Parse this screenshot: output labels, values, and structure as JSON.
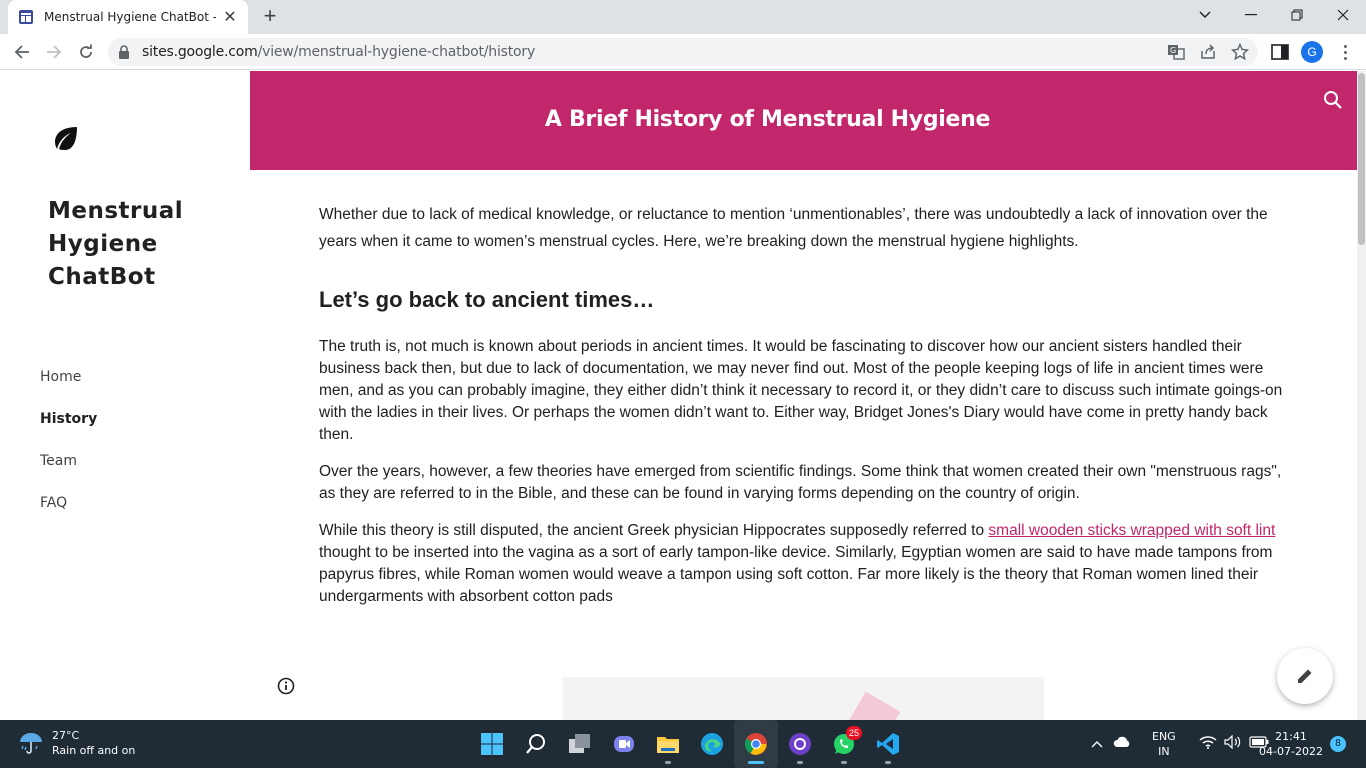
{
  "browser": {
    "tab_title": "Menstrual Hygiene ChatBot - History",
    "url_host": "sites.google.com",
    "url_path": "/view/menstrual-hygiene-chatbot/history",
    "profile_initial": "G"
  },
  "site": {
    "title": "Menstrual Hygiene ChatBot",
    "nav": [
      {
        "label": "Home",
        "active": false
      },
      {
        "label": "History",
        "active": true
      },
      {
        "label": "Team",
        "active": false
      },
      {
        "label": "FAQ",
        "active": false
      }
    ],
    "banner_title": "A Brief History of Menstrual Hygiene"
  },
  "content": {
    "lead": "Whether due to lack of medical knowledge, or reluctance to mention ‘unmentionables’, there was undoubtedly a lack of innovation over the years when it came to women’s menstrual cycles. Here, we’re breaking down the menstrual hygiene highlights.",
    "heading": "Let’s go back to ancient times…",
    "para1": "The truth is, not much is known about periods in ancient times. It would be fascinating to discover how our ancient sisters handled their business back then, but due to lack of documentation, we may never find out. Most of the people keeping logs of life in ancient times were men, and as you can probably imagine, they either didn’t think it necessary to record it, or they didn’t care to discuss such intimate goings-on with the ladies in their lives. Or perhaps the women didn’t want to. Either way, Bridget Jones's Diary would have come in pretty handy back then.",
    "para2": "Over the years, however, a few theories have emerged from scientific findings. Some think that women created their own \"menstruous rags\", as they are referred to in the Bible, and these can be found in varying forms depending on the country of origin.",
    "para3_before": "While this theory is still disputed, the ancient Greek physician Hippocrates supposedly referred to ",
    "para3_link": "small wooden sticks wrapped with soft lint",
    "para3_after": " thought to be inserted into the vagina as a sort of early tampon-like device. Similarly, Egyptian women are said to have made tampons from papyrus fibres, while Roman women would weave a tampon using soft cotton. Far more likely is the theory that Roman women lined their undergarments with absorbent cotton pads"
  },
  "taskbar": {
    "temperature": "27°C",
    "weather": "Rain off and on",
    "whatsapp_badge": "25",
    "lang_top": "ENG",
    "lang_bottom": "IN",
    "time": "21:41",
    "date": "04-07-2022",
    "notifications": "8"
  },
  "colors": {
    "brand": "#c2266b",
    "taskbar": "#1f2c36"
  },
  "icons": [
    "google-sites-icon",
    "close-icon",
    "plus-icon",
    "back-arrow-icon",
    "forward-arrow-icon",
    "reload-icon",
    "lock-icon",
    "translate-icon",
    "share-icon",
    "star-icon",
    "side-panel-icon",
    "kebab-menu-icon",
    "leaf-icon",
    "search-icon",
    "info-icon",
    "pencil-icon",
    "umbrella-rain-icon",
    "windows-start-icon",
    "taskbar-search-icon",
    "task-view-icon",
    "teams-icon",
    "file-explorer-icon",
    "edge-icon",
    "chrome-icon",
    "github-desktop-icon",
    "whatsapp-icon",
    "vscode-icon",
    "chevron-up-icon",
    "onedrive-icon",
    "wifi-icon",
    "volume-icon",
    "battery-icon"
  ]
}
